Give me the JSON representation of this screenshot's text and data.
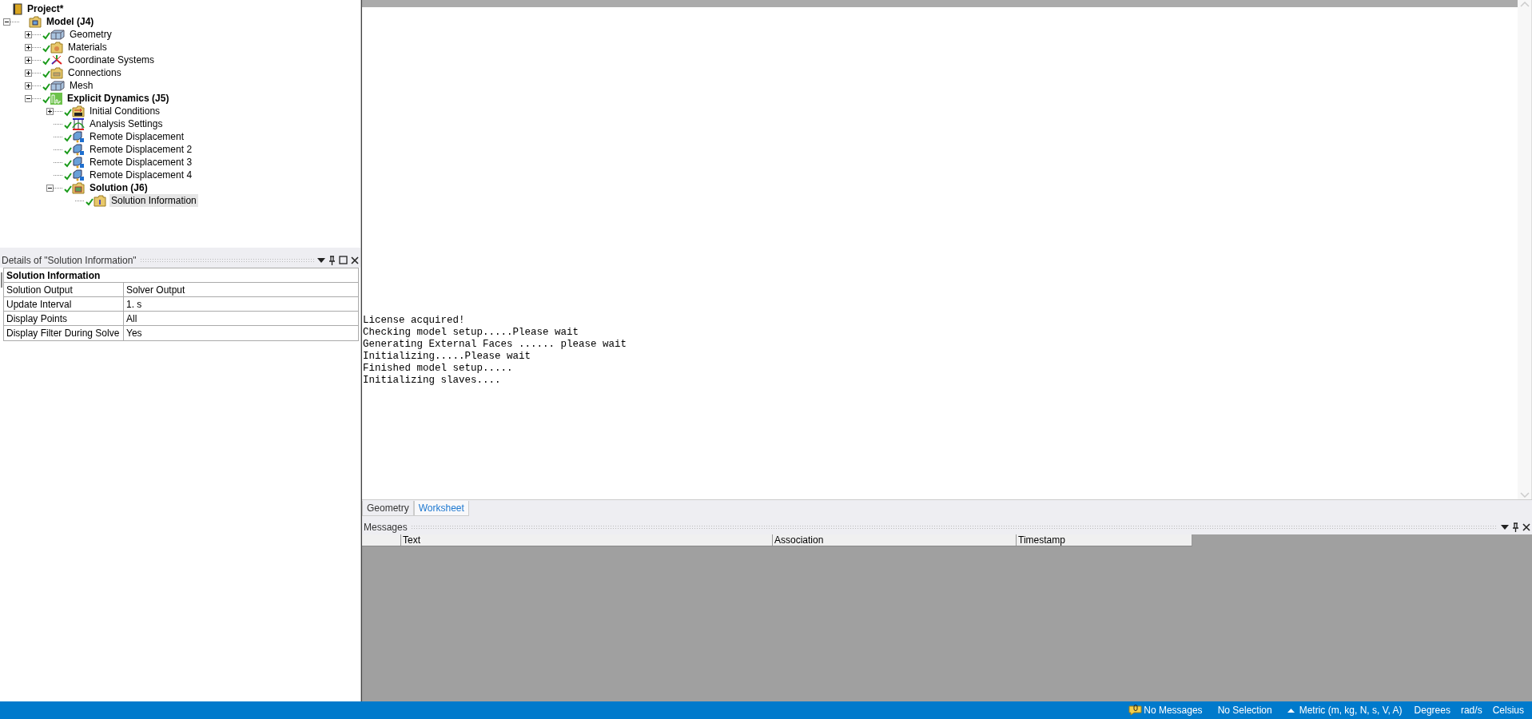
{
  "tree": [
    {
      "label": "Project*",
      "kind": "project",
      "bold": true,
      "solved": false,
      "selected": false,
      "children": [
        {
          "label": "Model (J4)",
          "kind": "model",
          "bold": true,
          "solved": false,
          "selected": false,
          "expanded": true,
          "children": [
            {
              "label": "Geometry",
              "kind": "geometry",
              "bold": false,
              "solved": true,
              "selected": false,
              "expanded": false
            },
            {
              "label": "Materials",
              "kind": "materials",
              "bold": false,
              "solved": true,
              "selected": false,
              "expanded": false
            },
            {
              "label": "Coordinate Systems",
              "kind": "coordinates",
              "bold": false,
              "solved": true,
              "selected": false,
              "expanded": false
            },
            {
              "label": "Connections",
              "kind": "connections",
              "bold": false,
              "solved": true,
              "selected": false,
              "expanded": false
            },
            {
              "label": "Mesh",
              "kind": "mesh",
              "bold": false,
              "solved": true,
              "selected": false,
              "expanded": false
            },
            {
              "label": "Explicit Dynamics (J5)",
              "kind": "explicit",
              "bold": true,
              "solved": true,
              "selected": false,
              "expanded": true,
              "children": [
                {
                  "label": "Initial Conditions",
                  "kind": "initial",
                  "bold": false,
                  "solved": true,
                  "selected": false,
                  "expanded": false
                },
                {
                  "label": "Analysis Settings",
                  "kind": "analysis",
                  "bold": false,
                  "solved": true,
                  "selected": false
                },
                {
                  "label": "Remote Displacement",
                  "kind": "remote",
                  "bold": false,
                  "solved": true,
                  "selected": false
                },
                {
                  "label": "Remote Displacement 2",
                  "kind": "remote",
                  "bold": false,
                  "solved": true,
                  "selected": false
                },
                {
                  "label": "Remote Displacement 3",
                  "kind": "remote",
                  "bold": false,
                  "solved": true,
                  "selected": false
                },
                {
                  "label": "Remote Displacement 4",
                  "kind": "remote",
                  "bold": false,
                  "solved": true,
                  "selected": false
                },
                {
                  "label": "Solution (J6)",
                  "kind": "solution",
                  "bold": true,
                  "solved": true,
                  "selected": false,
                  "expanded": true,
                  "children": [
                    {
                      "label": "Solution Information",
                      "kind": "info",
                      "bold": false,
                      "solved": true,
                      "selected": true
                    }
                  ]
                }
              ]
            }
          ]
        }
      ]
    }
  ],
  "details": {
    "title": "Details of \"Solution Information\"",
    "group": "Solution Information",
    "expanded": true,
    "rows": [
      {
        "name": "Solution Output",
        "value": "Solver Output"
      },
      {
        "name": "Update Interval",
        "value": "1. s"
      },
      {
        "name": "Display Points",
        "value": "All"
      },
      {
        "name": "Display Filter During Solve",
        "value": "Yes"
      }
    ]
  },
  "output": {
    "lines": [
      "License acquired!",
      "Checking model setup.....Please wait",
      "Generating External Faces ...... please wait",
      "Initializing.....Please wait",
      "Finished model setup.....",
      "Initializing slaves...."
    ]
  },
  "tabs": [
    {
      "label": "Geometry",
      "selected": false
    },
    {
      "label": "Worksheet",
      "selected": true
    }
  ],
  "messages": {
    "title": "Messages",
    "columns": [
      "Text",
      "Association",
      "Timestamp"
    ]
  },
  "status_bar": {
    "messages": "No Messages",
    "selection": "No Selection",
    "units": "Metric (m, kg, N, s, V, A)",
    "angle": "Degrees",
    "rotation": "rad/s",
    "temperature": "Celsius"
  }
}
